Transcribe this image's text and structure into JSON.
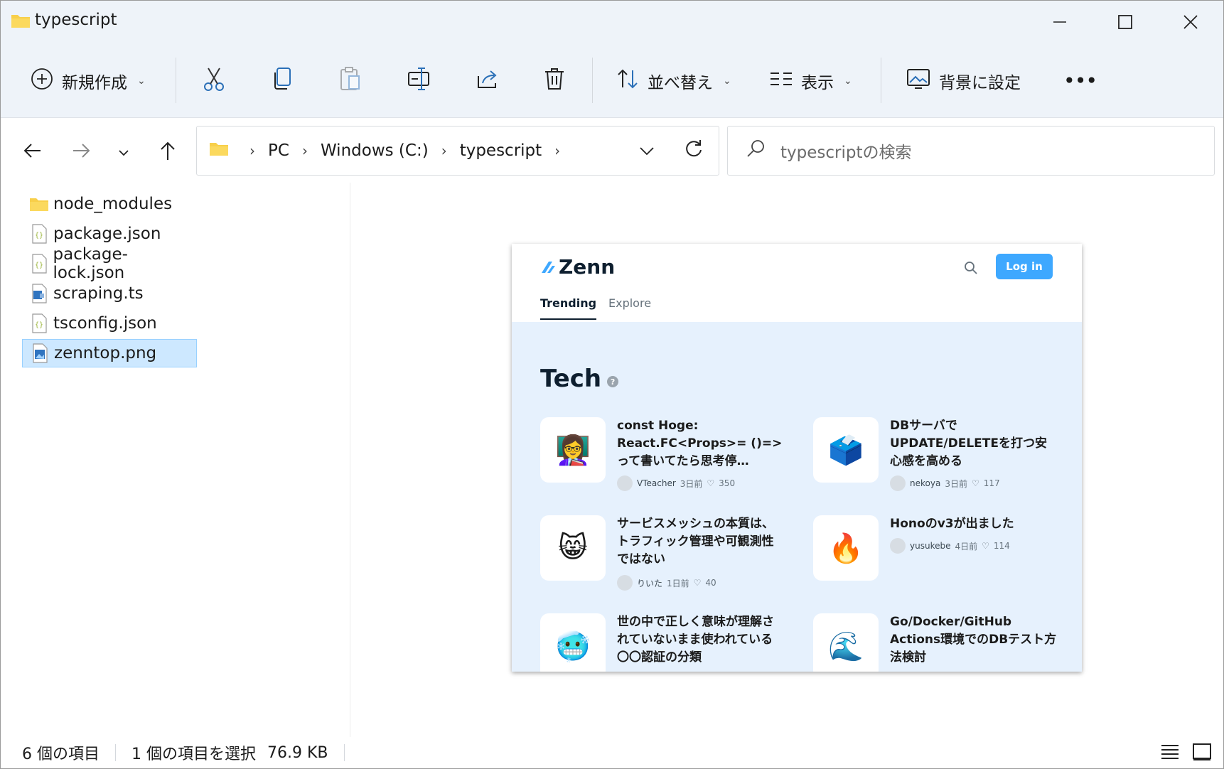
{
  "window": {
    "title": "typescript"
  },
  "toolbar": {
    "new_label": "新規作成",
    "sort_label": "並べ替え",
    "view_label": "表示",
    "background_label": "背景に設定",
    "more_label": "•••"
  },
  "breadcrumb": [
    "PC",
    "Windows (C:)",
    "typescript"
  ],
  "search": {
    "placeholder": "typescriptの検索"
  },
  "files": [
    {
      "name": "node_modules",
      "type": "folder"
    },
    {
      "name": "package.json",
      "type": "json"
    },
    {
      "name": "package-lock.json",
      "type": "json"
    },
    {
      "name": "scraping.ts",
      "type": "ts"
    },
    {
      "name": "tsconfig.json",
      "type": "json"
    },
    {
      "name": "zenntop.png",
      "type": "png",
      "selected": true
    }
  ],
  "preview": {
    "logo": "Zenn",
    "login": "Log in",
    "tabs": [
      "Trending",
      "Explore"
    ],
    "section": "Tech",
    "articles": [
      {
        "title": "const Hoge: React.FC<Props>= ()=>って書いてたら思考停…",
        "emoji": "👩‍🏫",
        "user": "VTeacher",
        "time": "3日前",
        "likes": "350"
      },
      {
        "title": "DBサーバで UPDATE/DELETEを打つ安心感を高める",
        "emoji": "🗳️",
        "user": "nekoya",
        "time": "3日前",
        "likes": "117"
      },
      {
        "title": "サービスメッシュの本質は、トラフィック管理や可観測性ではない",
        "emoji": "😸",
        "user": "りいた",
        "time": "1日前",
        "likes": "40"
      },
      {
        "title": "Honoのv3が出ました",
        "emoji": "🔥",
        "user": "yusukebe",
        "time": "4日前",
        "likes": "114"
      },
      {
        "title": "世の中で正しく意味が理解されていないまま使われている〇〇認証の分類",
        "emoji": "🥶",
        "user": "",
        "time": "",
        "likes": ""
      },
      {
        "title": "Go/Docker/GitHub Actions環境でのDBテスト方法検討",
        "emoji": "🌊",
        "user": "",
        "time": "",
        "likes": ""
      }
    ]
  },
  "status": {
    "count": "6 個の項目",
    "selected": "1 個の項目を選択",
    "size": "76.9 KB"
  },
  "colors": {
    "accent": "#3ea8ff",
    "selection": "#cde8ff",
    "chrome": "#eef3f9"
  }
}
